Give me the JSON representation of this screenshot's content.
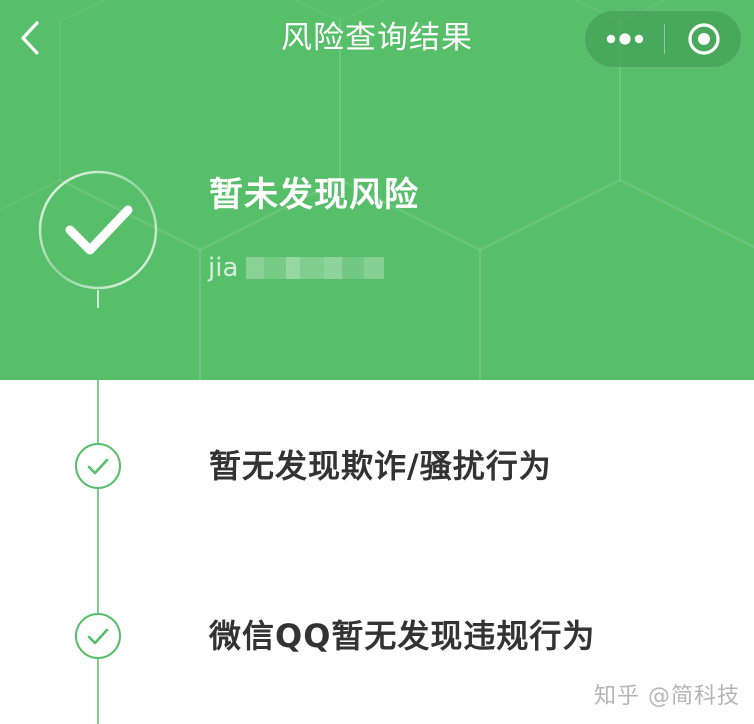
{
  "nav": {
    "title": "风险查询结果"
  },
  "result": {
    "status_title": "暂未发现风险",
    "account_prefix": "jia"
  },
  "steps": [
    {
      "label": "暂无发现欺诈/骚扰行为"
    },
    {
      "label": "微信QQ暂无发现违规行为"
    }
  ],
  "watermark": "知乎 @简科技",
  "colors": {
    "header_bg": "#57be6a",
    "accent_green": "#57be6a",
    "timeline": "#7fd08e",
    "step_text": "#333333"
  }
}
